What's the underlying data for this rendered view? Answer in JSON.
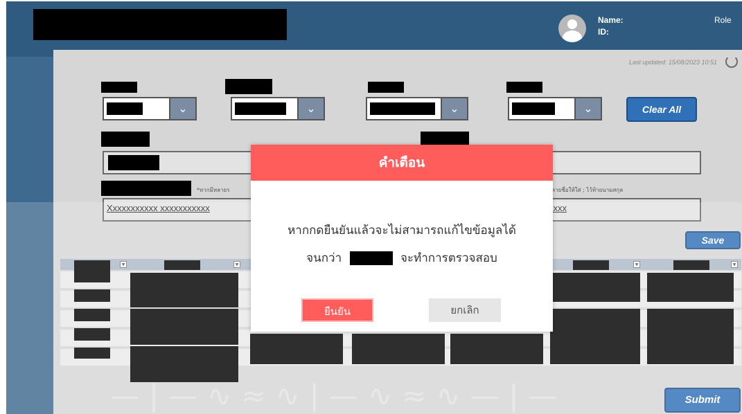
{
  "header": {
    "name_label": "Name:",
    "id_label": "ID:",
    "role_label": "Role"
  },
  "panel": {
    "last_updated": "Last updated: 15/08/2023 10:51",
    "clear_all": "Clear All",
    "save": "Save",
    "submit": "Submit",
    "hint_left": "*หากมีหลายร",
    "hint_right": "หลายชื่อให้ใส่ ; ไว้ท้ายนามสกุล",
    "text_field_value": "Xxxxxxxxxxx xxxxxxxxxxx",
    "text_field_tail": "xxxx"
  },
  "modal": {
    "title": "คำเตือน",
    "message_line1": "หากกดยืนยันแล้วจะไม่สามารถแก้ไขข้อมูลได้",
    "message_line2_before": "จนกว่า",
    "message_line2_after": "จะทำการตรวจสอบ",
    "confirm": "ยืนยัน",
    "cancel": "ยกเลิก"
  },
  "colors": {
    "header_blue": "#2f5b80",
    "accent_red": "#ff5c5c",
    "button_blue": "#2f70b7"
  }
}
